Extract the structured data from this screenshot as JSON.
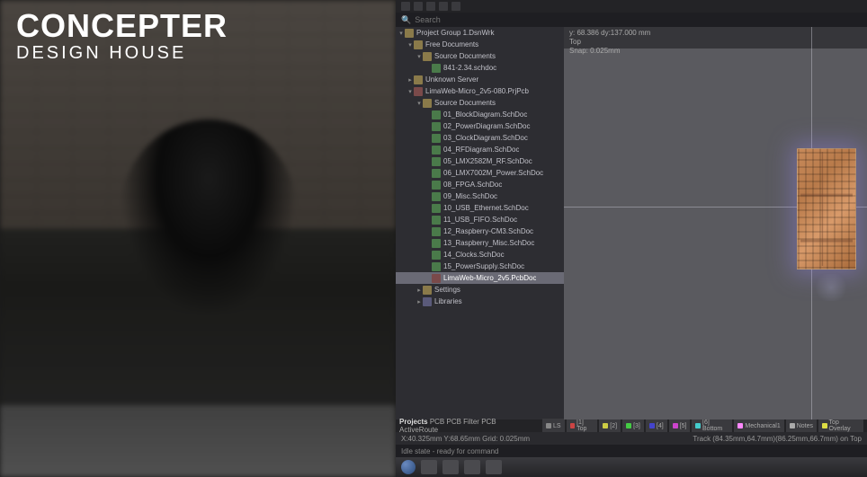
{
  "logo": {
    "main": "CONCEPTER",
    "sub": "DESIGN HOUSE"
  },
  "search": {
    "placeholder": "Search"
  },
  "coords": {
    "line1": "y: 68.386    dy:137.000  mm",
    "line2": "Top",
    "line3": "Snap: 0.025mm"
  },
  "tree": [
    {
      "level": 0,
      "expand": "▾",
      "icon": "folder",
      "label": "Project Group 1.DsnWrk"
    },
    {
      "level": 1,
      "expand": "▾",
      "icon": "folder",
      "label": "Free Documents"
    },
    {
      "level": 2,
      "expand": "▾",
      "icon": "folder",
      "label": "Source Documents"
    },
    {
      "level": 3,
      "expand": "",
      "icon": "schdoc",
      "label": "841-2.34.schdoc"
    },
    {
      "level": 1,
      "expand": "▸",
      "icon": "folder",
      "label": "Unknown Server"
    },
    {
      "level": 1,
      "expand": "▾",
      "icon": "pcb",
      "label": "LimaWeb-Micro_2v5-080.PrjPcb"
    },
    {
      "level": 2,
      "expand": "▾",
      "icon": "folder",
      "label": "Source Documents"
    },
    {
      "level": 3,
      "expand": "",
      "icon": "schdoc",
      "label": "01_BlockDiagram.SchDoc"
    },
    {
      "level": 3,
      "expand": "",
      "icon": "schdoc",
      "label": "02_PowerDiagram.SchDoc"
    },
    {
      "level": 3,
      "expand": "",
      "icon": "schdoc",
      "label": "03_ClockDiagram.SchDoc"
    },
    {
      "level": 3,
      "expand": "",
      "icon": "schdoc",
      "label": "04_RFDiagram.SchDoc"
    },
    {
      "level": 3,
      "expand": "",
      "icon": "schdoc",
      "label": "05_LMX2582M_RF.SchDoc"
    },
    {
      "level": 3,
      "expand": "",
      "icon": "schdoc",
      "label": "06_LMX7002M_Power.SchDoc"
    },
    {
      "level": 3,
      "expand": "",
      "icon": "schdoc",
      "label": "08_FPGA.SchDoc"
    },
    {
      "level": 3,
      "expand": "",
      "icon": "schdoc",
      "label": "09_Misc.SchDoc"
    },
    {
      "level": 3,
      "expand": "",
      "icon": "schdoc",
      "label": "10_USB_Ethernet.SchDoc"
    },
    {
      "level": 3,
      "expand": "",
      "icon": "schdoc",
      "label": "11_USB_FIFO.SchDoc"
    },
    {
      "level": 3,
      "expand": "",
      "icon": "schdoc",
      "label": "12_Raspberry-CM3.SchDoc"
    },
    {
      "level": 3,
      "expand": "",
      "icon": "schdoc",
      "label": "13_Raspberry_Misc.SchDoc"
    },
    {
      "level": 3,
      "expand": "",
      "icon": "schdoc",
      "label": "14_Clocks.SchDoc"
    },
    {
      "level": 3,
      "expand": "",
      "icon": "schdoc",
      "label": "15_PowerSupply.SchDoc"
    },
    {
      "level": 3,
      "expand": "",
      "icon": "pcb",
      "label": "LimaWeb-Micro_2v5.PcbDoc",
      "selected": true
    },
    {
      "level": 2,
      "expand": "▸",
      "icon": "folder",
      "label": "Settings"
    },
    {
      "level": 2,
      "expand": "▸",
      "icon": "lib",
      "label": "Libraries"
    }
  ],
  "bottomTabs": {
    "items": [
      "Projects",
      "PCB",
      "PCB Filter",
      "PCB ActiveRoute"
    ],
    "active": 0
  },
  "layerTabs": [
    {
      "label": "LS",
      "color": "#888"
    },
    {
      "label": "[1] Top",
      "color": "#cc4444"
    },
    {
      "label": "[2]",
      "color": "#cccc44"
    },
    {
      "label": "[3]",
      "color": "#44cc44"
    },
    {
      "label": "[4]",
      "color": "#4444cc"
    },
    {
      "label": "[5]",
      "color": "#cc44cc"
    },
    {
      "label": "[6] Bottom",
      "color": "#44cccc"
    },
    {
      "label": "Mechanical1",
      "color": "#ff88ff"
    },
    {
      "label": "Notes",
      "color": "#aaaaaa"
    },
    {
      "label": "Top Overlay",
      "color": "#dddd44"
    }
  ],
  "statusBar": {
    "left": "X:40.325mm Y:68.65mm   Grid: 0.025mm",
    "right": "Track (84.35mm,64.7mm)(86.25mm,66.7mm) on Top"
  },
  "commandBar": {
    "text": "Idle state - ready for command"
  }
}
